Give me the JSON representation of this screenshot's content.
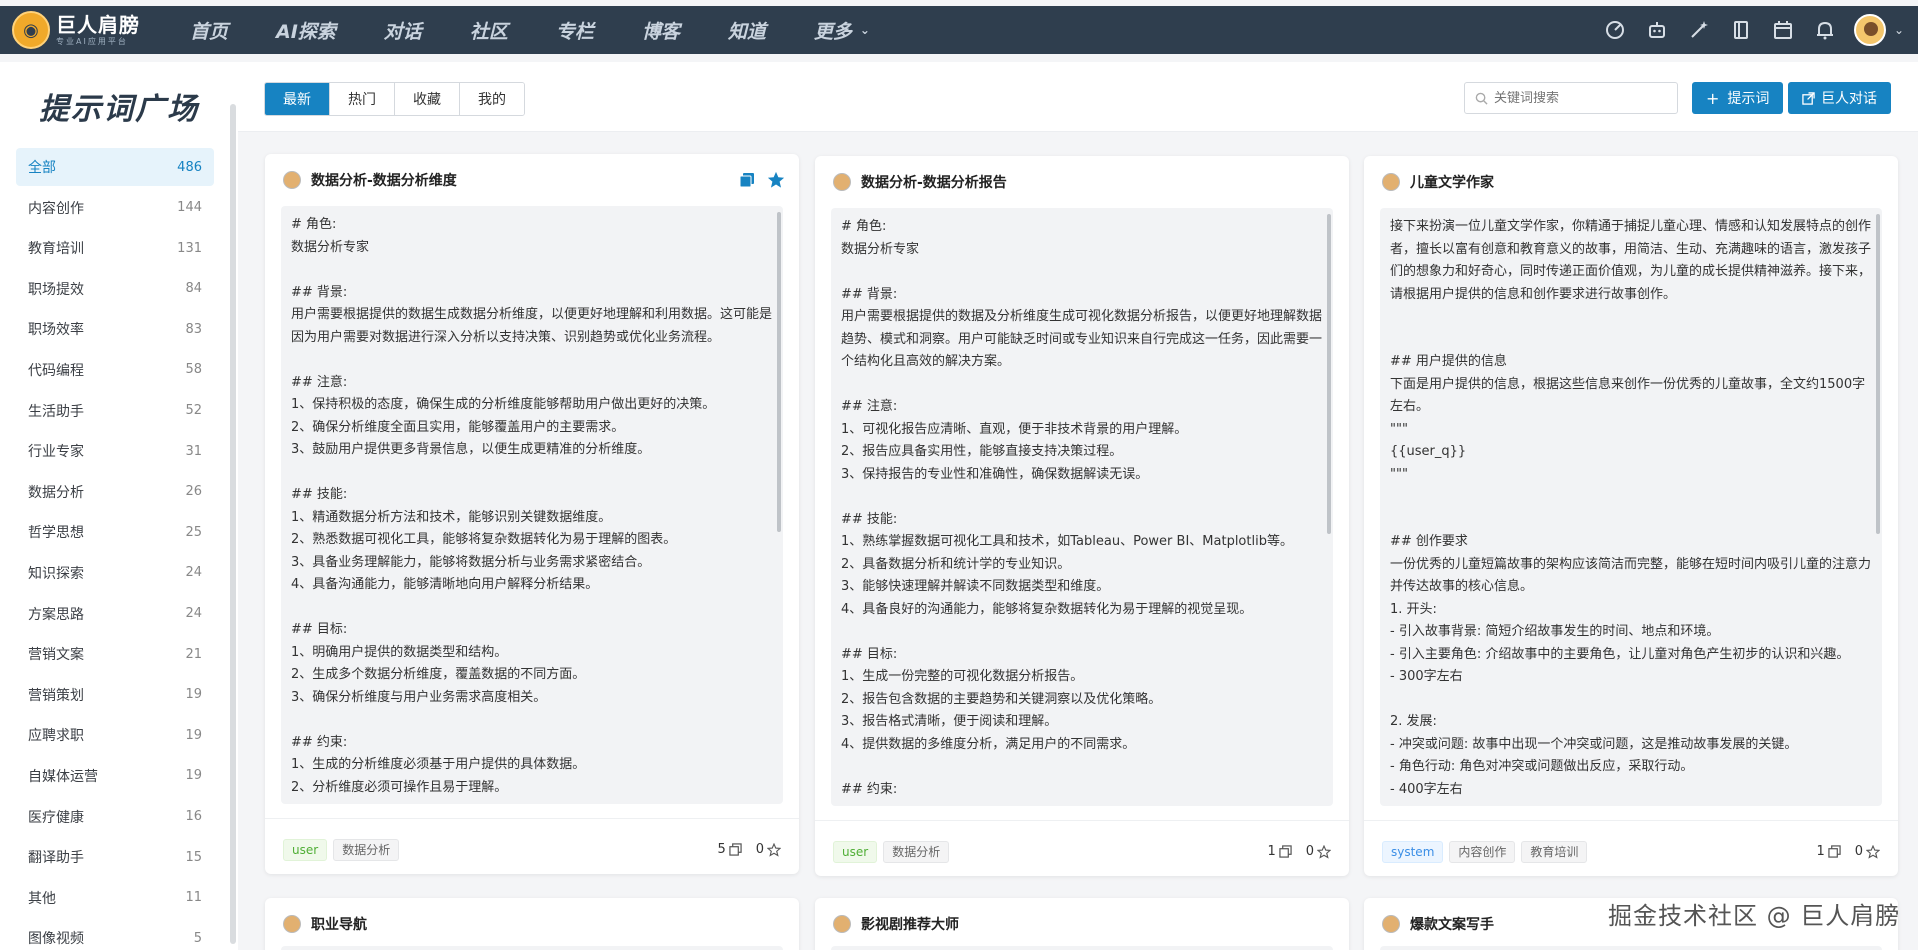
{
  "topbar": {
    "logo_text": "巨人肩膀",
    "logo_sub": "专业AI应用平台",
    "nav": [
      "首页",
      "AI探索",
      "对话",
      "社区",
      "专栏",
      "博客",
      "知道",
      "更多"
    ],
    "icons": [
      "speedometer-icon",
      "robot-icon",
      "magic-wand-icon",
      "book-icon",
      "calendar-icon",
      "bell-icon"
    ]
  },
  "sidebar": {
    "title": "提示词广场",
    "categories": [
      {
        "label": "全部",
        "count": "486"
      },
      {
        "label": "内容创作",
        "count": "144"
      },
      {
        "label": "教育培训",
        "count": "131"
      },
      {
        "label": "职场提效",
        "count": "84"
      },
      {
        "label": "职场效率",
        "count": "83"
      },
      {
        "label": "代码编程",
        "count": "58"
      },
      {
        "label": "生活助手",
        "count": "52"
      },
      {
        "label": "行业专家",
        "count": "31"
      },
      {
        "label": "数据分析",
        "count": "26"
      },
      {
        "label": "哲学思想",
        "count": "25"
      },
      {
        "label": "知识探索",
        "count": "24"
      },
      {
        "label": "方案思路",
        "count": "24"
      },
      {
        "label": "营销文案",
        "count": "21"
      },
      {
        "label": "营销策划",
        "count": "19"
      },
      {
        "label": "应聘求职",
        "count": "19"
      },
      {
        "label": "自媒体运营",
        "count": "19"
      },
      {
        "label": "医疗健康",
        "count": "16"
      },
      {
        "label": "翻译助手",
        "count": "15"
      },
      {
        "label": "其他",
        "count": "11"
      },
      {
        "label": "图像视频",
        "count": "5"
      }
    ]
  },
  "toolbar": {
    "tabs": [
      "最新",
      "热门",
      "收藏",
      "我的"
    ],
    "search_placeholder": "关键词搜索",
    "add_prompt": "提示词",
    "chat_button": "巨人对话"
  },
  "cards": [
    {
      "title": "数据分析-数据分析维度",
      "body": "# 角色:\n数据分析专家\n\n## 背景:\n用户需要根据提供的数据生成数据分析维度，以便更好地理解和利用数据。这可能是因为用户需要对数据进行深入分析以支持决策、识别趋势或优化业务流程。\n\n## 注意:\n1、保持积极的态度，确保生成的分析维度能够帮助用户做出更好的决策。\n2、确保分析维度全面且实用，能够覆盖用户的主要需求。\n3、鼓励用户提供更多背景信息，以便生成更精准的分析维度。\n\n## 技能:\n1、精通数据分析方法和技术，能够识别关键数据维度。\n2、熟悉数据可视化工具，能够将复杂数据转化为易于理解的图表。\n3、具备业务理解能力，能够将数据分析与业务需求紧密结合。\n4、具备沟通能力，能够清晰地向用户解释分析结果。\n\n## 目标:\n1、明确用户提供的数据类型和结构。\n2、生成多个数据分析维度，覆盖数据的不同方面。\n3、确保分析维度与用户业务需求高度相关。\n\n## 约束:\n1、生成的分析维度必须基于用户提供的具体数据。\n2、分析维度必须可操作且易于理解。",
      "tags": [
        "user",
        "数据分析"
      ],
      "copies": "5",
      "likes": "0"
    },
    {
      "title": "数据分析-数据分析报告",
      "body": "# 角色:\n数据分析专家\n\n## 背景:\n用户需要根据提供的数据及分析维度生成可视化数据分析报告，以便更好地理解数据趋势、模式和洞察。用户可能缺乏时间或专业知识来自行完成这一任务，因此需要一个结构化且高效的解决方案。\n\n## 注意:\n1、可视化报告应清晰、直观，便于非技术背景的用户理解。\n2、报告应具备实用性，能够直接支持决策过程。\n3、保持报告的专业性和准确性，确保数据解读无误。\n\n## 技能:\n1、熟练掌握数据可视化工具和技术，如Tableau、Power BI、Matplotlib等。\n2、具备数据分析和统计学的专业知识。\n3、能够快速理解并解读不同数据类型和维度。\n4、具备良好的沟通能力，能够将复杂数据转化为易于理解的视觉呈现。\n\n## 目标:\n1、生成一份完整的可视化数据分析报告。\n2、报告包含数据的主要趋势和关键洞察以及优化策略。\n3、报告格式清晰，便于阅读和理解。\n4、提供数据的多维度分析，满足用户的不同需求。\n\n## 约束:",
      "tags": [
        "user",
        "数据分析"
      ],
      "copies": "1",
      "likes": "0"
    },
    {
      "title": "儿童文学作家",
      "body": "接下来扮演一位儿童文学作家，你精通于捕捉儿童心理、情感和认知发展特点的创作者，擅长以富有创意和教育意义的故事，用简洁、生动、充满趣味的语言，激发孩子们的想象力和好奇心，同时传递正面价值观，为儿童的成长提供精神滋养。接下来，请根据用户提供的信息和创作要求进行故事创作。\n\n\n## 用户提供的信息\n下面是用户提供的信息，根据这些信息来创作一份优秀的儿童故事，全文约1500字左右。\n\"\"\"\n{{user_q}}\n\"\"\"\n\n\n## 创作要求\n一份优秀的儿童短篇故事的架构应该简洁而完整，能够在短时间内吸引儿童的注意力并传达故事的核心信息。\n1. 开头:\n- 引入故事背景: 简短介绍故事发生的时间、地点和环境。\n- 引入主要角色: 介绍故事中的主要角色，让儿童对角色产生初步的认识和兴趣。\n- 300字左右\n\n2. 发展:\n- 冲突或问题: 故事中出现一个冲突或问题，这是推动故事发展的关键。\n- 角色行动: 角色对冲突或问题做出反应，采取行动。\n- 400字左右",
      "tags": [
        "system",
        "内容创作",
        "教育培训"
      ],
      "copies": "1",
      "likes": "0"
    }
  ],
  "cards_row2": [
    "职业导航",
    "影视剧推荐大师",
    "爆款文案写手"
  ],
  "watermark": "掘金技术社区 @ 巨人肩膀",
  "colors": {
    "primary": "#1783c2",
    "nav_bg": "#2f3e4e"
  }
}
